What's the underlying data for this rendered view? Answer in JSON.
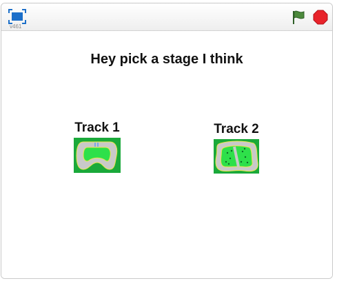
{
  "player": {
    "version": "v461",
    "icons": {
      "fullscreen": "fullscreen-icon",
      "green_flag": "green-flag-icon",
      "stop": "stop-icon"
    },
    "colors": {
      "fullscreen_blue": "#1c6fc9",
      "flag_green": "#4c8a3c",
      "stop_red": "#e8232a",
      "grass_green": "#1aa93a",
      "track_grey": "#c9c9c9",
      "inner_green": "#2ee04a",
      "edge_yellow": "#e8e84a"
    }
  },
  "stage": {
    "title": "Hey pick a stage I think",
    "tracks": [
      {
        "label": "Track 1"
      },
      {
        "label": "Track 2"
      }
    ]
  }
}
